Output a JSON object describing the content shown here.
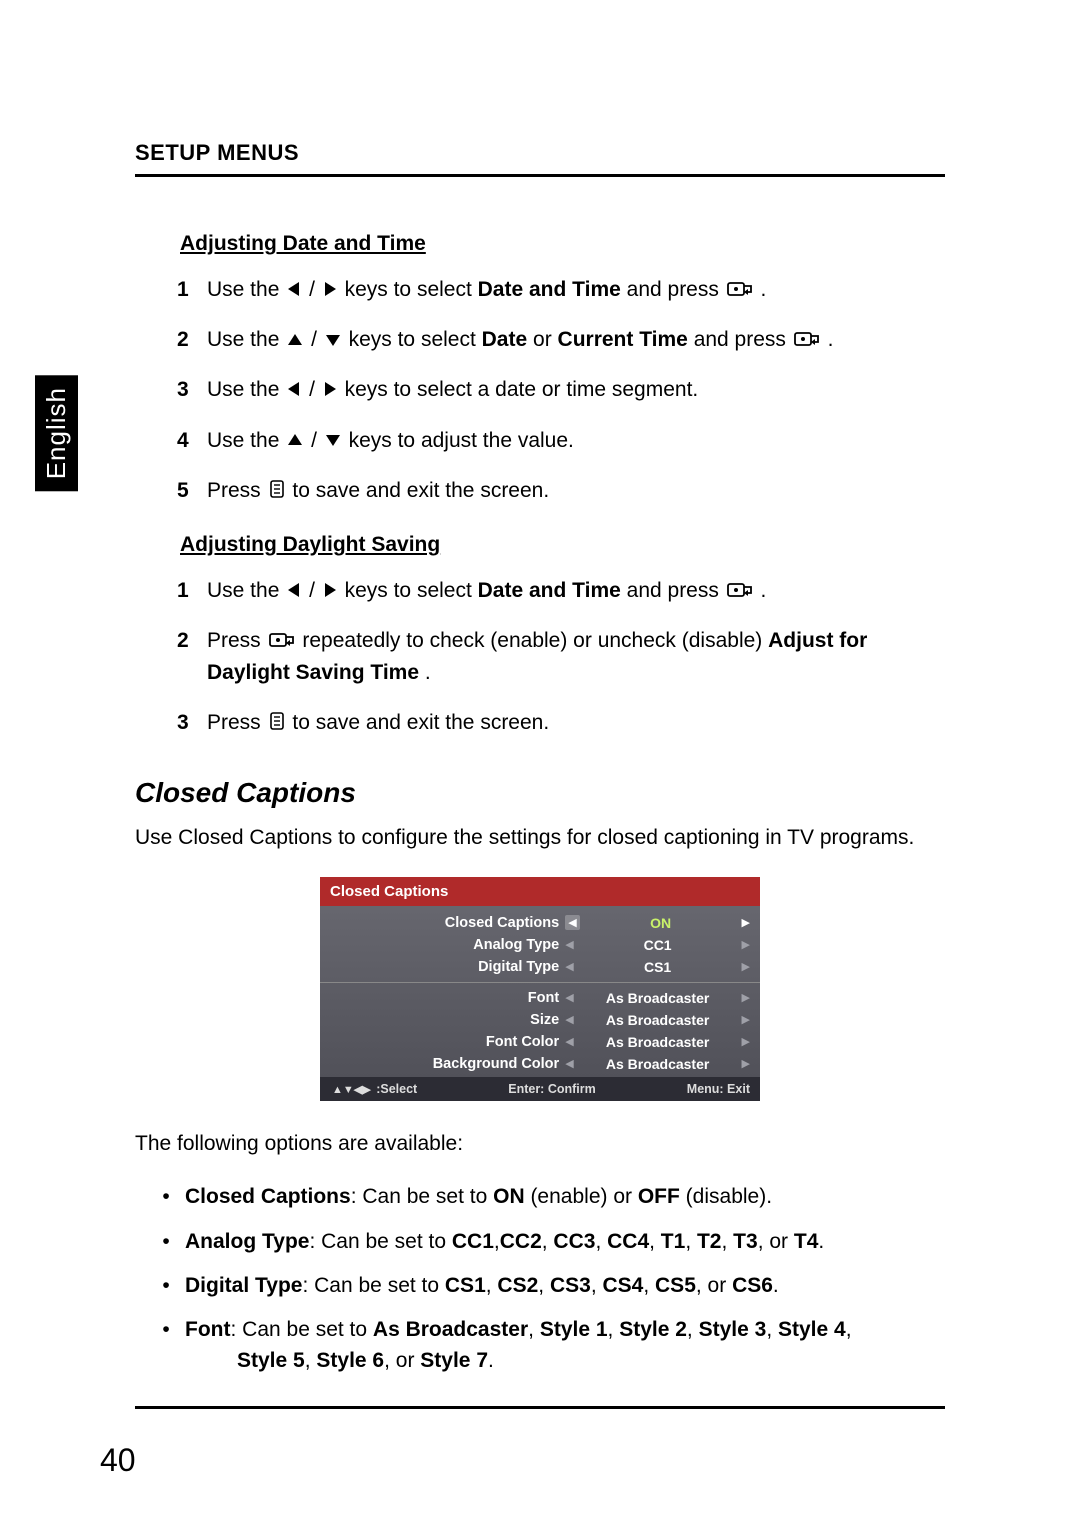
{
  "side_tab": "English",
  "section_header": "SETUP MENUS",
  "sub1": "Adjusting Date and Time",
  "steps_a": {
    "s1a": "Use the ",
    "s1b": " / ",
    "s1c": " keys to select ",
    "s1d": "Date and Time",
    "s1e": " and press ",
    "s1f": ".",
    "s2a": "Use the ",
    "s2b": " / ",
    "s2c": " keys to select ",
    "s2d": "Date",
    "s2e": " or ",
    "s2f": "Current Time",
    "s2g": " and press ",
    "s2h": ".",
    "s3a": "Use the ",
    "s3b": " / ",
    "s3c": " keys to select a date or time segment.",
    "s4a": "Use the ",
    "s4b": " / ",
    "s4c": " keys to adjust the value.",
    "s5a": "Press ",
    "s5b": " to save and exit the screen."
  },
  "sub2": "Adjusting Daylight Saving",
  "steps_b": {
    "s1a": "Use the ",
    "s1b": " / ",
    "s1c": " keys to select ",
    "s1d": "Date and Time",
    "s1e": " and press ",
    "s1f": ".",
    "s2a": "Press ",
    "s2b": " repeatedly to check (enable) or uncheck (disable) ",
    "s2c": "Adjust for Daylight Saving Time",
    "s2d": ".",
    "s3a": "Press ",
    "s3b": " to save and exit the screen."
  },
  "cc_heading": "Closed Captions",
  "cc_intro": "Use Closed Captions to configure the settings for closed captioning in TV programs.",
  "osd": {
    "title": "Closed Captions",
    "rows_top": [
      {
        "label": "Closed Captions",
        "value": "ON",
        "hl": true
      },
      {
        "label": "Analog Type",
        "value": "CC1",
        "hl": false
      },
      {
        "label": "Digital Type",
        "value": "CS1",
        "hl": false
      }
    ],
    "rows_bottom": [
      {
        "label": "Font",
        "value": "As Broadcaster"
      },
      {
        "label": "Size",
        "value": "As Broadcaster"
      },
      {
        "label": "Font Color",
        "value": "As Broadcaster"
      },
      {
        "label": "Background Color",
        "value": "As Broadcaster"
      }
    ],
    "footer_left": ":Select",
    "footer_mid": "Enter: Confirm",
    "footer_right": "Menu: Exit"
  },
  "options_intro": "The following options are available:",
  "bullets": {
    "b1_lead": "Closed Captions",
    "b1_rest_a": ": Can be set to ",
    "b1_on": "ON",
    "b1_rest_b": " (enable) or ",
    "b1_off": "OFF",
    "b1_rest_c": " (disable).",
    "b2_lead": "Analog Type",
    "b2_rest_a": ": Can be set to ",
    "b2_v1": "CC1",
    "b2_c1": ",",
    "b2_v2": "CC2",
    "b2_c2": ", ",
    "b2_v3": "CC3",
    "b2_c3": ", ",
    "b2_v4": "CC4",
    "b2_c4": ", ",
    "b2_v5": "T1",
    "b2_c5": ", ",
    "b2_v6": "T2",
    "b2_c6": ", ",
    "b2_v7": "T3",
    "b2_c7": ", or ",
    "b2_v8": "T4",
    "b2_c8": ".",
    "b3_lead": "Digital Type",
    "b3_rest_a": ": Can be set to ",
    "b3_v1": "CS1",
    "b3_c1": ", ",
    "b3_v2": "CS2",
    "b3_c2": ", ",
    "b3_v3": "CS3",
    "b3_c3": ", ",
    "b3_v4": "CS4",
    "b3_c4": ", ",
    "b3_v5": "CS5",
    "b3_c5": ", or ",
    "b3_v6": "CS6",
    "b3_c6": ".",
    "b4_lead": "Font",
    "b4_rest_a": ": Can be set to ",
    "b4_v1": "As Broadcaster",
    "b4_c1": ", ",
    "b4_v2": "Style 1",
    "b4_c2": ", ",
    "b4_v3": "Style 2",
    "b4_c3": ", ",
    "b4_v4": "Style 3",
    "b4_c4": ", ",
    "b4_v5": "Style 4",
    "b4_c5": ", ",
    "b4_v6": "Style 5",
    "b4_c6": ", ",
    "b4_v7": "Style 6",
    "b4_c7": ", or ",
    "b4_v8": "Style 7",
    "b4_c8": "."
  },
  "page_number": "40"
}
